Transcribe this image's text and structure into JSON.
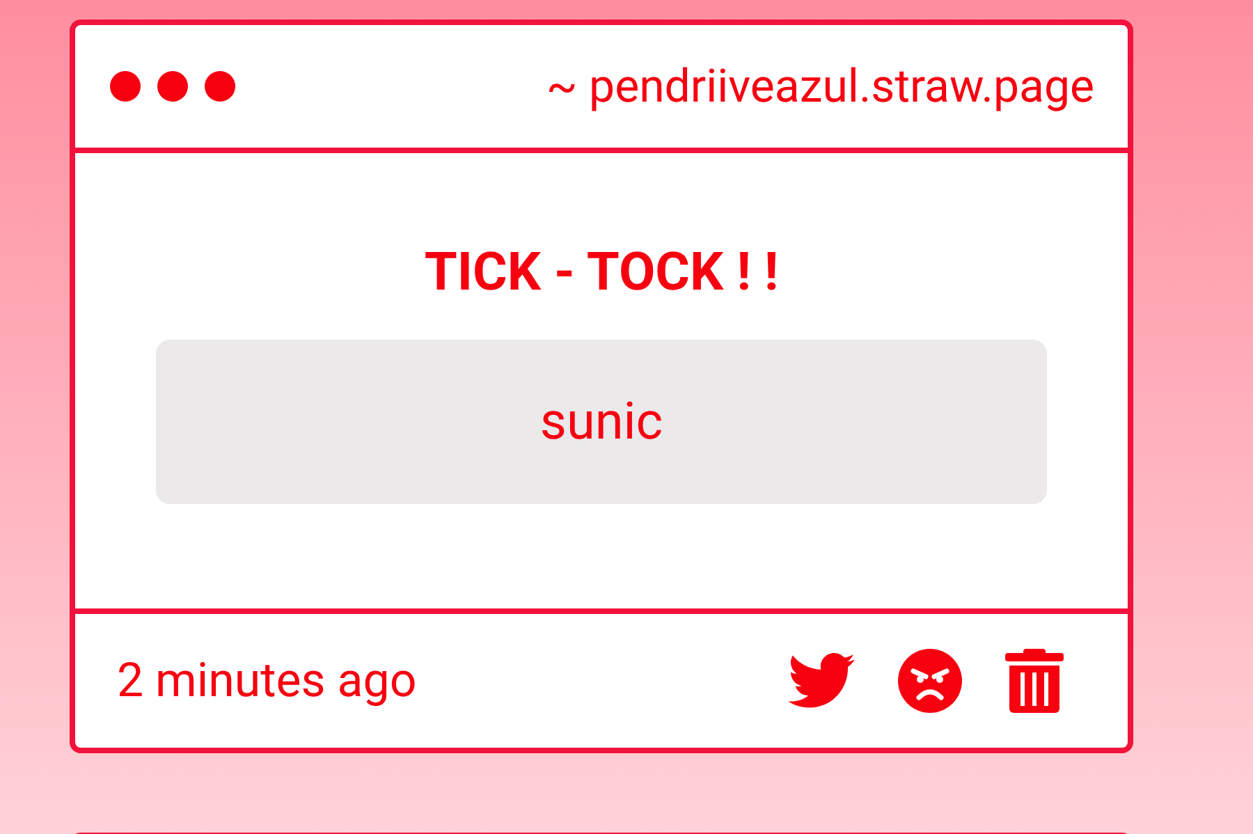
{
  "window": {
    "url": "~ pendriiveazul.straw.page"
  },
  "message": {
    "title": "TICK - TOCK ! !",
    "answer": "sunic"
  },
  "footer": {
    "time": "2 minutes ago"
  }
}
